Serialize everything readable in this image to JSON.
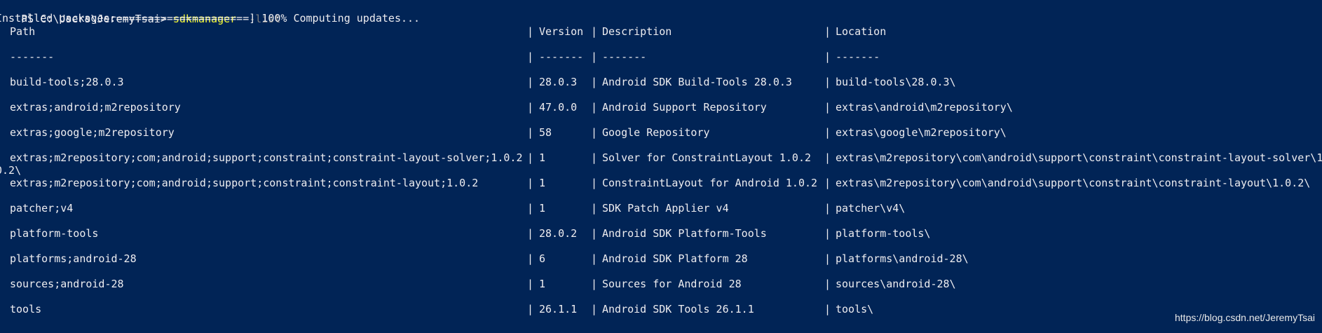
{
  "terminal": {
    "prompt": "PS C:\\Users\\JeremyTsai> ",
    "command": "sdkmanager",
    "argument": " --list",
    "progress_line": "Installed packages:=====================] 100% Computing updates..."
  },
  "table": {
    "separator": "|",
    "headers": {
      "path": "Path",
      "version": "Version",
      "description": "Description",
      "location": "Location"
    },
    "dashes": {
      "path": "-------",
      "version": "-------",
      "description": "-------",
      "location": "-------"
    },
    "rows": [
      {
        "path": "build-tools;28.0.3",
        "version": "28.0.3",
        "description": "Android SDK Build-Tools 28.0.3",
        "location": "build-tools\\28.0.3\\"
      },
      {
        "path": "extras;android;m2repository",
        "version": "47.0.0",
        "description": "Android Support Repository",
        "location": "extras\\android\\m2repository\\"
      },
      {
        "path": "extras;google;m2repository",
        "version": "58",
        "description": "Google Repository",
        "location": "extras\\google\\m2repository\\"
      },
      {
        "path": "extras;m2repository;com;android;support;constraint;constraint-layout-solver;1.0.2",
        "version": "1",
        "description": "Solver for ConstraintLayout 1.0.2",
        "location": "extras\\m2repository\\com\\android\\support\\constraint\\constraint-layout-solver\\1"
      },
      {
        "path": "extras;m2repository;com;android;support;constraint;constraint-layout;1.0.2",
        "version": "1",
        "description": "ConstraintLayout for Android 1.0.2",
        "location": "extras\\m2repository\\com\\android\\support\\constraint\\constraint-layout\\1.0.2\\"
      },
      {
        "path": "patcher;v4",
        "version": "1",
        "description": "SDK Patch Applier v4",
        "location": "patcher\\v4\\"
      },
      {
        "path": "platform-tools",
        "version": "28.0.2",
        "description": "Android SDK Platform-Tools",
        "location": "platform-tools\\"
      },
      {
        "path": "platforms;android-28",
        "version": "6",
        "description": "Android SDK Platform 28",
        "location": "platforms\\android-28\\"
      },
      {
        "path": "sources;android-28",
        "version": "1",
        "description": "Sources for Android 28",
        "location": "sources\\android-28\\"
      },
      {
        "path": "tools",
        "version": "26.1.1",
        "description": "Android SDK Tools 26.1.1",
        "location": "tools\\"
      }
    ],
    "wrap_overflow": "0.2\\"
  },
  "watermark": "https://blog.csdn.net/JeremyTsai",
  "colors": {
    "background": "#012456",
    "foreground": "#eeedf0",
    "command": "#fcff38",
    "parameter": "#7f7f7f"
  }
}
